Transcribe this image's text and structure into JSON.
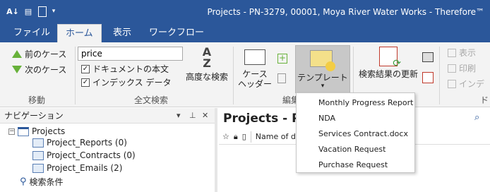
{
  "window": {
    "title": "Projects - PN-3279, 00001, Moya River Water Works - Therefore™"
  },
  "tabs": [
    {
      "label": "ファイル"
    },
    {
      "label": "ホーム"
    },
    {
      "label": "表示"
    },
    {
      "label": "ワークフロー"
    }
  ],
  "ribbon": {
    "move": {
      "prev_case": "前のケース",
      "next_case": "次のケース",
      "group_label": "移動"
    },
    "fulltext": {
      "search_value": "price",
      "doc_body_label": "ドキュメントの本文",
      "index_data_label": "インデックス データ",
      "advanced_search": "高度な検索",
      "group_label": "全文検索"
    },
    "edit": {
      "case_header_line1": "ケース",
      "case_header_line2": "ヘッダー",
      "template_label": "テンプレート",
      "group_label_partial": "編集"
    },
    "result": {
      "update_results": "検索結果の更新"
    },
    "view": {
      "show": "表示",
      "print": "印刷",
      "index_partial": "インデ",
      "group_label_partial": "ド"
    }
  },
  "template_menu": {
    "items": [
      "Monthly Progress Report",
      "NDA",
      "Services Contract.docx",
      "Vacation Request",
      "Purchase Request"
    ]
  },
  "navigation": {
    "title": "ナビゲーション",
    "tree": {
      "root": "Projects",
      "children": [
        "Project_Reports (0)",
        "Project_Contracts (0)",
        "Project_Emails (2)"
      ],
      "search_conditions": "検索条件"
    }
  },
  "main": {
    "title": "Projects - P",
    "name_column_partial": "Name of d"
  },
  "colors": {
    "brand_blue": "#2b579a",
    "ribbon_bg": "#f3f3f3",
    "arrow_green": "#67b13a"
  }
}
